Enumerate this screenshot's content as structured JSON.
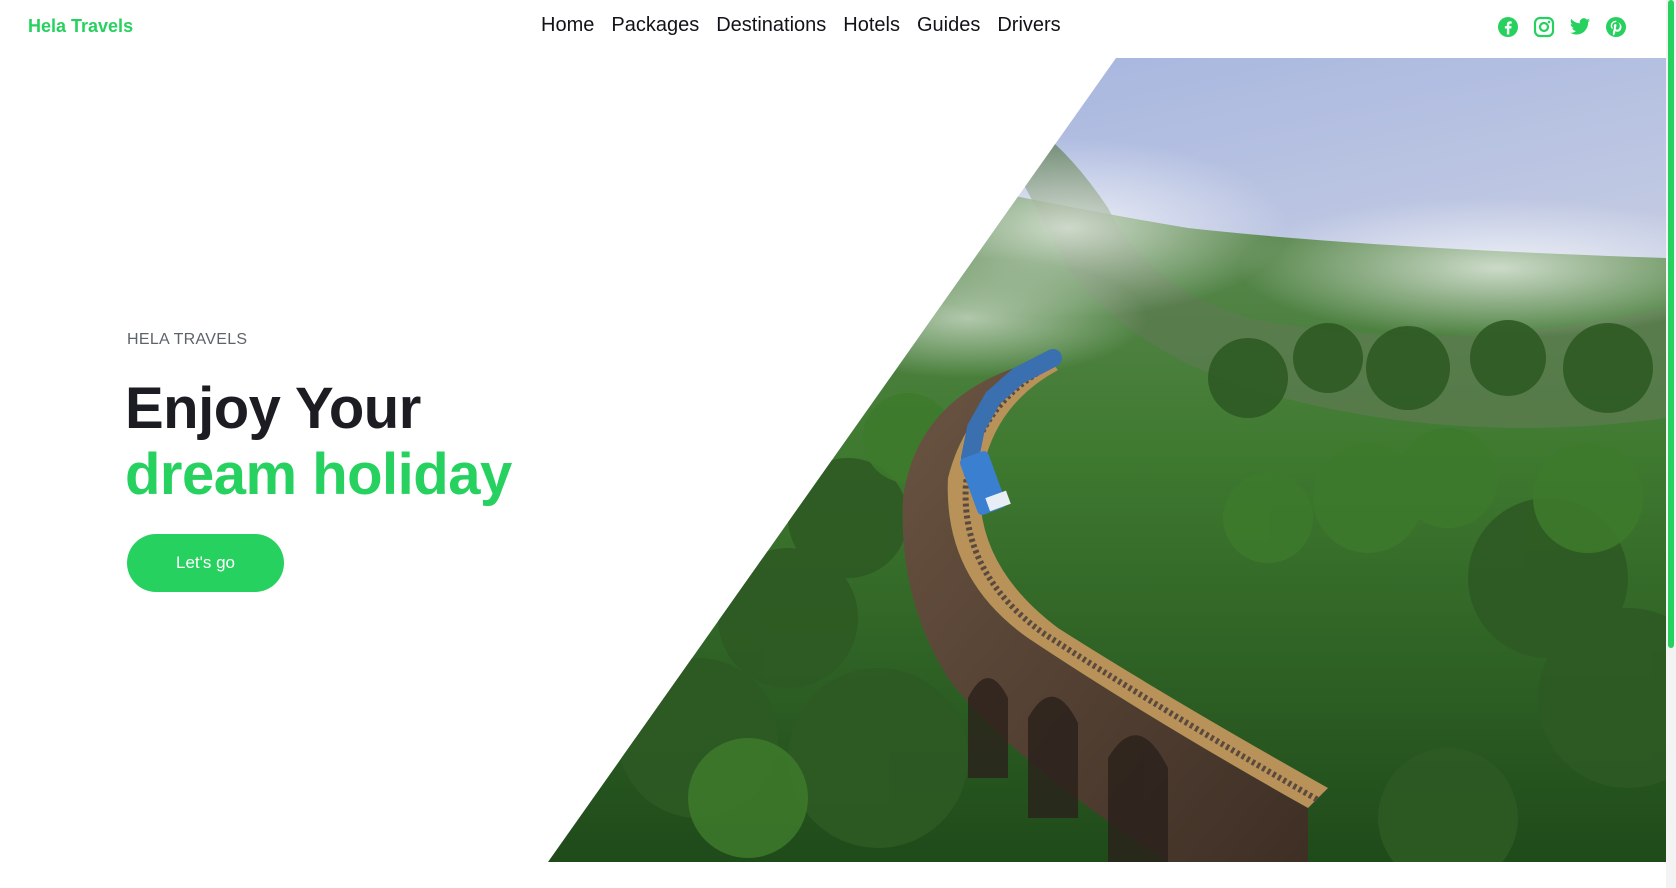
{
  "nav": {
    "brand": "Hela Travels",
    "links": [
      {
        "label": "Home"
      },
      {
        "label": "Packages"
      },
      {
        "label": "Destinations"
      },
      {
        "label": "Hotels"
      },
      {
        "label": "Guides"
      },
      {
        "label": "Drivers"
      }
    ],
    "socials": [
      "facebook-icon",
      "instagram-icon",
      "twitter-icon",
      "pinterest-icon"
    ]
  },
  "hero": {
    "eyebrow": "HELA TRAVELS",
    "title_line1": "Enjoy Your",
    "title_line2": "dream holiday",
    "cta": "Let's go",
    "image": "train-on-nine-arch-bridge-through-jungle"
  },
  "colors": {
    "accent": "#27d15f",
    "heading": "#1b1d22",
    "muted": "#5d636b"
  }
}
